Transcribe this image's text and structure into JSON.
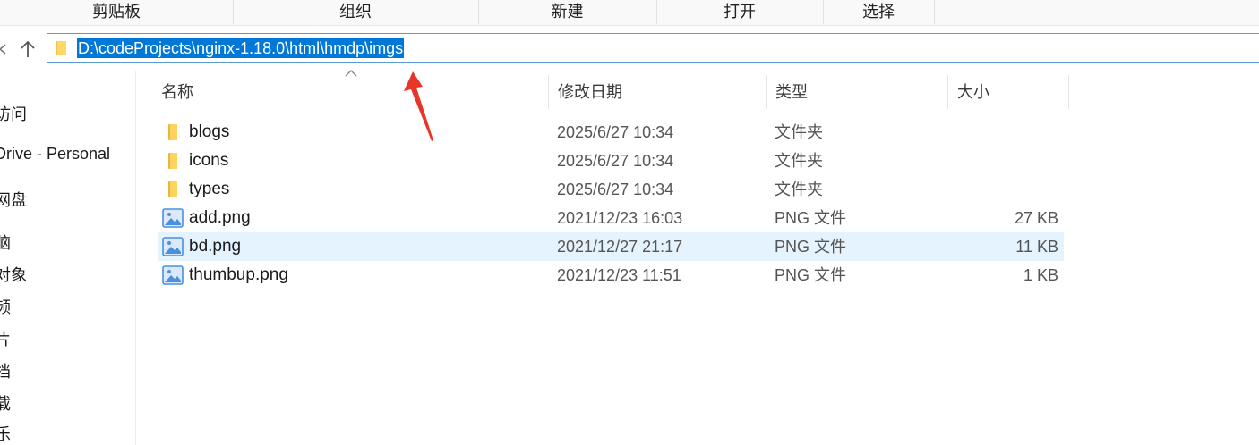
{
  "ribbon": {
    "groups": [
      "剪贴板",
      "组织",
      "新建",
      "打开",
      "选择"
    ]
  },
  "nav": {
    "back_icon": "left-arrow-icon",
    "up_icon": "up-arrow-icon"
  },
  "address": {
    "path": "D:\\codeProjects\\nginx-1.18.0\\html\\hmdp\\imgs",
    "selection_color": "#0078d7"
  },
  "sidebar": {
    "items": [
      "访问",
      "Drive - Personal",
      "网盘",
      "脑",
      "对象",
      "频",
      "片",
      "档",
      "载",
      "乐"
    ]
  },
  "columns": {
    "name": "名称",
    "date": "修改日期",
    "type": "类型",
    "size": "大小"
  },
  "files": [
    {
      "name": "blogs",
      "date": "2025/6/27 10:34",
      "type": "文件夹",
      "size": "",
      "icon": "folder-icon"
    },
    {
      "name": "icons",
      "date": "2025/6/27 10:34",
      "type": "文件夹",
      "size": "",
      "icon": "folder-icon"
    },
    {
      "name": "types",
      "date": "2025/6/27 10:34",
      "type": "文件夹",
      "size": "",
      "icon": "folder-icon"
    },
    {
      "name": "add.png",
      "date": "2021/12/23 16:03",
      "type": "PNG 文件",
      "size": "27 KB",
      "icon": "image-file-icon"
    },
    {
      "name": "bd.png",
      "date": "2021/12/27 21:17",
      "type": "PNG 文件",
      "size": "11 KB",
      "icon": "image-file-icon"
    },
    {
      "name": "thumbup.png",
      "date": "2021/12/23 11:51",
      "type": "PNG 文件",
      "size": "1 KB",
      "icon": "image-file-icon"
    }
  ],
  "colors": {
    "accent": "#0078d7",
    "selected_row": "#e5f3ff",
    "annotation_arrow": "#e8352a"
  }
}
